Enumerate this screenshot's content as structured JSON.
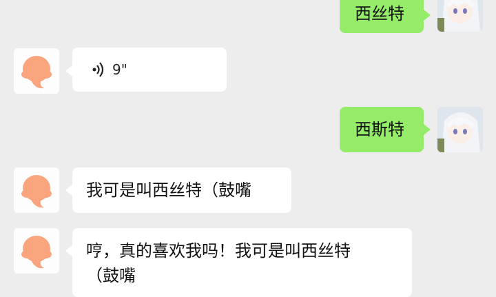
{
  "messages": [
    {
      "side": "right",
      "text": "西丝特"
    },
    {
      "side": "left",
      "type": "voice",
      "duration": "9\""
    },
    {
      "side": "right",
      "text": "西斯特"
    },
    {
      "side": "left",
      "text": "我可是叫西丝特（鼓嘴"
    },
    {
      "side": "left",
      "text_line1": "哼，真的喜欢我吗！我可是叫西丝特",
      "text_line2": "（鼓嘴"
    }
  ]
}
